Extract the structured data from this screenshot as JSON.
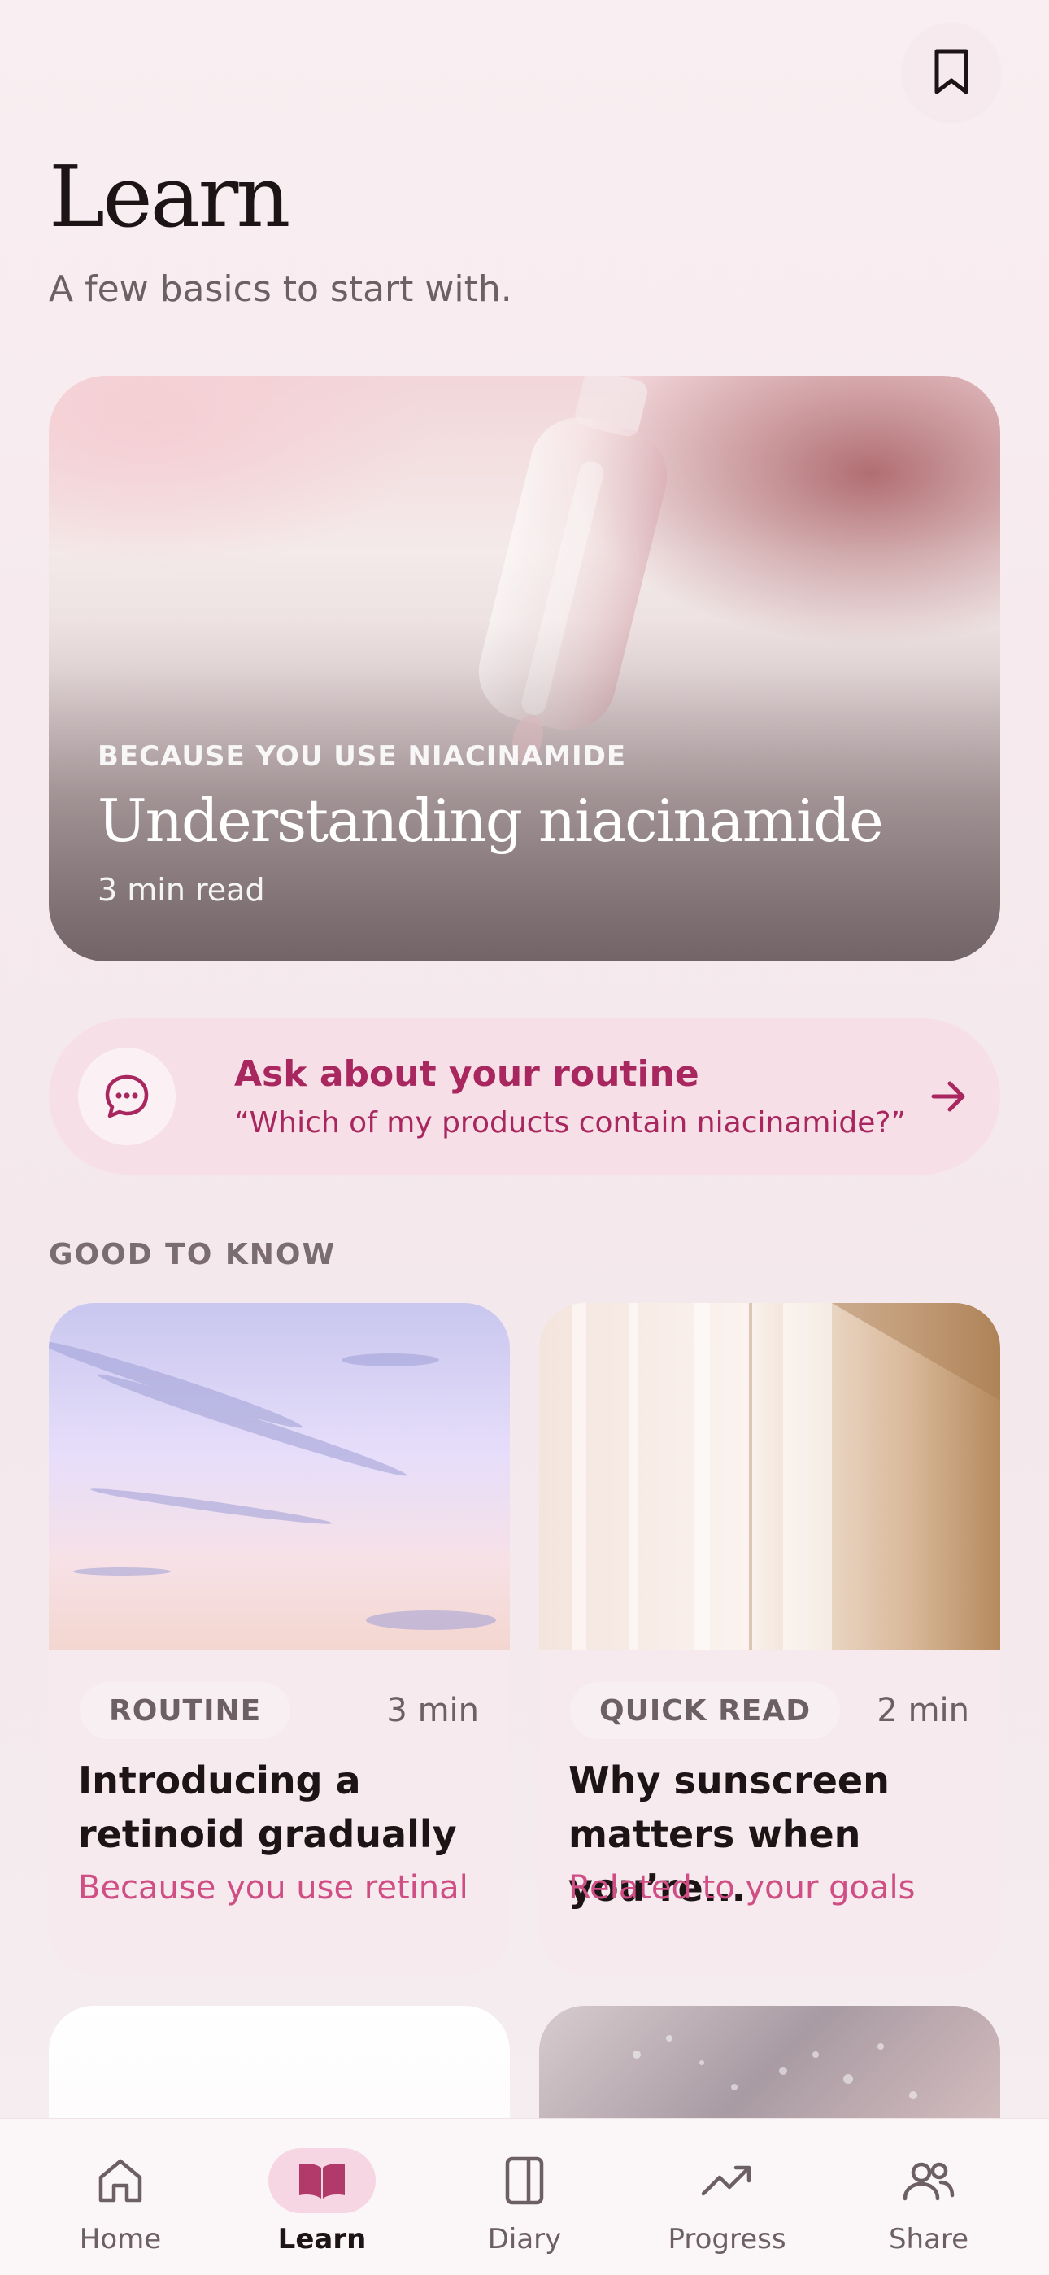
{
  "header": {
    "title": "Learn",
    "subtitle": "A few basics to start with."
  },
  "hero": {
    "eyebrow": "BECAUSE YOU USE NIACINAMIDE",
    "title": "Understanding niacinamide",
    "meta": "3 min read"
  },
  "ask": {
    "title": "Ask about your routine",
    "prompt": "“Which of my products contain niacinamide?”"
  },
  "section": {
    "label": "GOOD TO KNOW"
  },
  "cards": [
    {
      "tag": "ROUTINE",
      "duration": "3 min",
      "title": "Introducing a retinoid gradually",
      "reason": "Because you use retinal"
    },
    {
      "tag": "QUICK READ",
      "duration": "2 min",
      "title": "Why sunscreen matters when you’re...",
      "reason": "Related to your goals"
    }
  ],
  "tabs": [
    {
      "label": "Home",
      "icon": "home-icon"
    },
    {
      "label": "Learn",
      "icon": "book-icon",
      "active": true
    },
    {
      "label": "Diary",
      "icon": "diary-icon"
    },
    {
      "label": "Progress",
      "icon": "trend-icon"
    },
    {
      "label": "Share",
      "icon": "people-icon"
    }
  ],
  "colors": {
    "accent": "#a8275e",
    "reason": "#cf4f85",
    "ask_bg": "#f7dfe8",
    "tab_active_bg": "#f7d6e3"
  }
}
